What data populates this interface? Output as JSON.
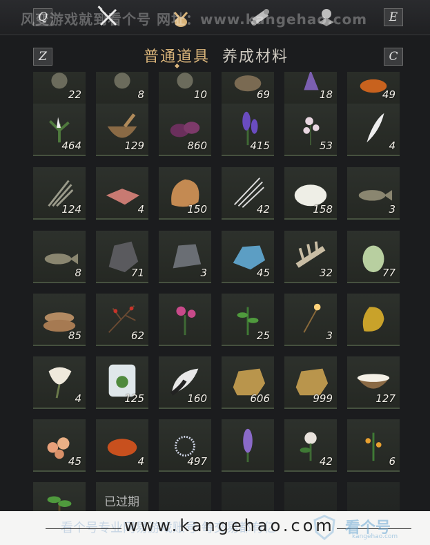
{
  "top_bar": {
    "keys": {
      "prev_category": "Q",
      "next_category": "E",
      "prev_tab": "Z",
      "next_tab": "C"
    },
    "watermark_text": "风变游戏就到看个号 网址：www.kangehao.com",
    "category_icons": [
      "crossed-swords-icon",
      "coin-pouch-icon",
      "scroll-icon",
      "gem-stand-icon"
    ]
  },
  "tabs": [
    {
      "label": "普通道具",
      "active": true
    },
    {
      "label": "养成材料",
      "active": false
    }
  ],
  "grid": {
    "rows": [
      [
        "22",
        "8",
        "10",
        "69",
        "18",
        "49"
      ],
      [
        "464",
        "129",
        "860",
        "415",
        "53",
        "4"
      ],
      [
        "124",
        "4",
        "150",
        "42",
        "158",
        "3"
      ],
      [
        "8",
        "71",
        "3",
        "45",
        "32",
        "77"
      ],
      [
        "85",
        "62",
        "",
        "25",
        "3",
        ""
      ],
      [
        "4",
        "125",
        "160",
        "606",
        "999",
        "127"
      ],
      [
        "45",
        "4",
        "497",
        "",
        "42",
        "6"
      ],
      [
        "",
        "",
        "",
        "",
        "",
        ""
      ]
    ],
    "item_icons": [
      [
        "item-icon",
        "item-icon",
        "item-icon",
        "ore-icon",
        "crystal-icon",
        "orange-item-icon"
      ],
      [
        "herb-plant-icon",
        "mortar-bowl-icon",
        "purple-flower-icon",
        "lavender-icon",
        "white-blossom-icon",
        "feather-icon"
      ],
      [
        "grass-bundle-icon",
        "raw-meat-icon",
        "fur-pelt-icon",
        "quills-icon",
        "white-fluff-icon",
        "fish-icon"
      ],
      [
        "fish-icon",
        "dark-ore-icon",
        "iron-ore-icon",
        "blue-crystal-icon",
        "bone-icon",
        "melon-icon"
      ],
      [
        "grain-sacks-icon",
        "red-berry-branch-icon",
        "pink-flower-icon",
        "green-herb-icon",
        "sparkler-icon",
        "gold-nugget-icon"
      ],
      [
        "white-flower-icon",
        "frozen-herb-icon",
        "white-tail-icon",
        "gold-ingot-icon",
        "gold-ingot-icon",
        "milk-bowl-icon"
      ],
      [
        "coral-chunks-icon",
        "amber-stone-icon",
        "silver-flower-icon",
        "purple-spike-flower-icon",
        "white-rose-icon",
        "orange-berry-plant-icon"
      ],
      [
        "sapling-icon",
        "expired-item-icon",
        "empty-slot",
        "empty-slot",
        "empty-slot",
        "empty-slot"
      ]
    ],
    "expired_label": "已过期"
  },
  "footer": {
    "faint_text": "看个号专业网易游戏账号 每交易都有亿",
    "url": "www.kangehao.com",
    "brand": "看个号",
    "brand_sub": "kangehao.com"
  },
  "colors": {
    "active_tab": "#d9b47a",
    "inactive_tab": "#cfcac1",
    "slot_border": "#46513f",
    "background": "#1b1c1e"
  }
}
